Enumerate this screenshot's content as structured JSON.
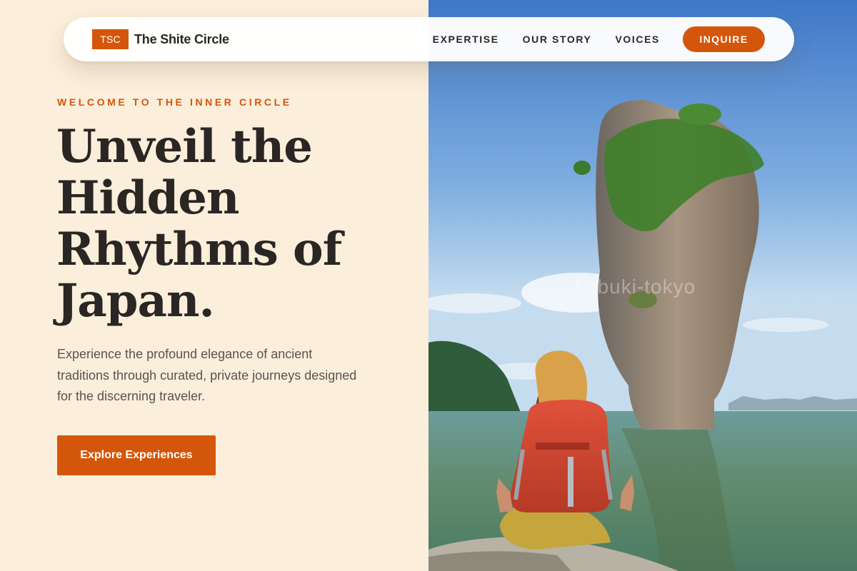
{
  "nav": {
    "logo_text": "TSC",
    "brand_name": "The Shite Circle",
    "links": [
      "EXPERTISE",
      "OUR STORY",
      "VOICES"
    ],
    "cta_label": "INQUIRE"
  },
  "hero": {
    "eyebrow": "WELCOME TO THE INNER CIRCLE",
    "headline": "Unveil the Hidden Rhythms of Japan.",
    "subtext": "Experience the profound elegance of ancient traditions through curated, private journeys designed for the discerning traveler.",
    "cta_label": "Explore Experiences"
  },
  "photo": {
    "watermark": "kabuki-tokyo"
  },
  "colors": {
    "accent": "#d4560a",
    "background": "#fbeedb",
    "heading": "#2a2624",
    "body_text": "#5b534d"
  }
}
